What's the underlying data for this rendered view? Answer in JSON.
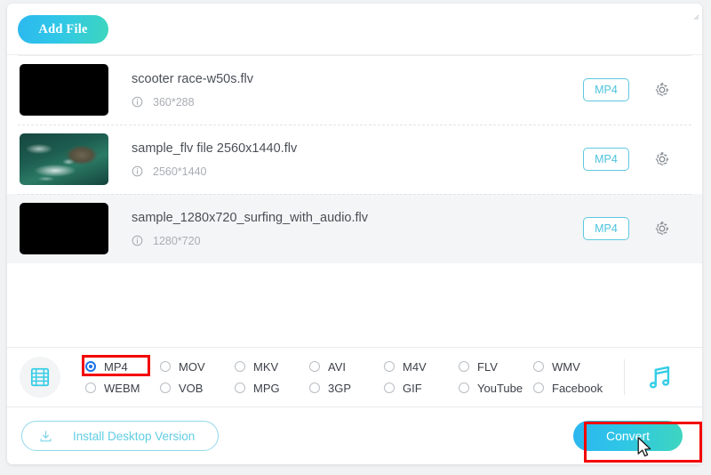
{
  "app": {
    "add_file_label": "Add File"
  },
  "file_list": [
    {
      "name": "scooter race-w50s.flv",
      "resolution": "360*288",
      "format": "MP4",
      "thumb_kind": "black",
      "highlighted": false
    },
    {
      "name": "sample_flv file 2560x1440.flv",
      "resolution": "2560*1440",
      "format": "MP4",
      "thumb_kind": "ocean",
      "highlighted": false
    },
    {
      "name": "sample_1280x720_surfing_with_audio.flv",
      "resolution": "1280*720",
      "format": "MP4",
      "thumb_kind": "black",
      "highlighted": true
    }
  ],
  "format_bar": {
    "media_type_icon": "film-strip-icon",
    "audio_icon": "music-note-icon",
    "selected": "MP4",
    "options": [
      "MP4",
      "MOV",
      "MKV",
      "AVI",
      "M4V",
      "FLV",
      "WMV",
      "WEBM",
      "VOB",
      "MPG",
      "3GP",
      "GIF",
      "YouTube",
      "Facebook"
    ]
  },
  "footer": {
    "install_label": "Install Desktop Version",
    "install_icon": "download-icon",
    "convert_label": "Convert"
  },
  "icons": {
    "info": "info-icon",
    "gear": "gear-icon"
  },
  "colors": {
    "accent_cyan": "#35cde6",
    "accent_teal": "#3ed5bf",
    "radio_selected": "#1a73e8",
    "annotation_red": "#f30000"
  }
}
